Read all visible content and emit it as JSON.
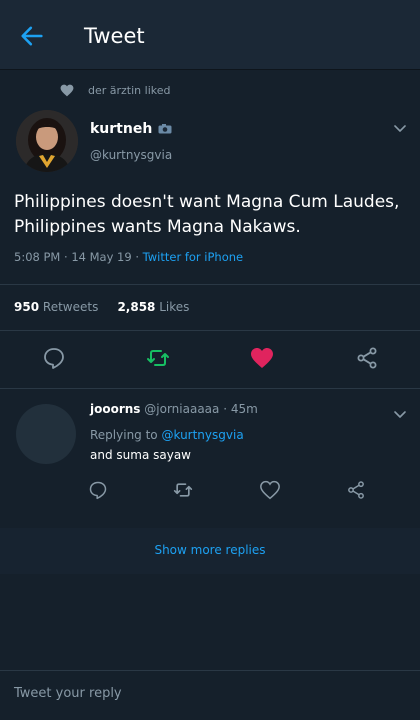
{
  "header": {
    "title": "Tweet",
    "back_icon": "arrow-left-icon"
  },
  "social_context": {
    "text": "der ärztin liked",
    "icon": "heart-icon"
  },
  "tweet": {
    "author_name": "kurtneh",
    "author_handle": "@kurtnysgvia",
    "badge_icon": "camera-emoji-icon",
    "text": "Philippines doesn't want Magna Cum Laudes, Philippines wants Magna Nakaws.",
    "time": "5:08 PM",
    "date": "14 May 19",
    "client": "Twitter for iPhone",
    "retweets": "950",
    "retweets_label": "Retweets",
    "likes": "2,858",
    "likes_label": "Likes",
    "liked": true,
    "colors": {
      "like": "#e0245e",
      "retweet": "#17bf63",
      "icon": "#8899a6"
    }
  },
  "reply": {
    "author_name": "jooorns",
    "author_handle": "@jorniaaaaa",
    "time": "45m",
    "replying_to_label": "Replying to",
    "replying_to": "@kurtnysgvia",
    "text": "and suma sayaw"
  },
  "show_more": "Show more replies",
  "compose": {
    "placeholder": "Tweet your reply"
  },
  "colors": {
    "background": "#15202b",
    "accent": "#1da1f2",
    "secondary_text": "#8899a6"
  }
}
